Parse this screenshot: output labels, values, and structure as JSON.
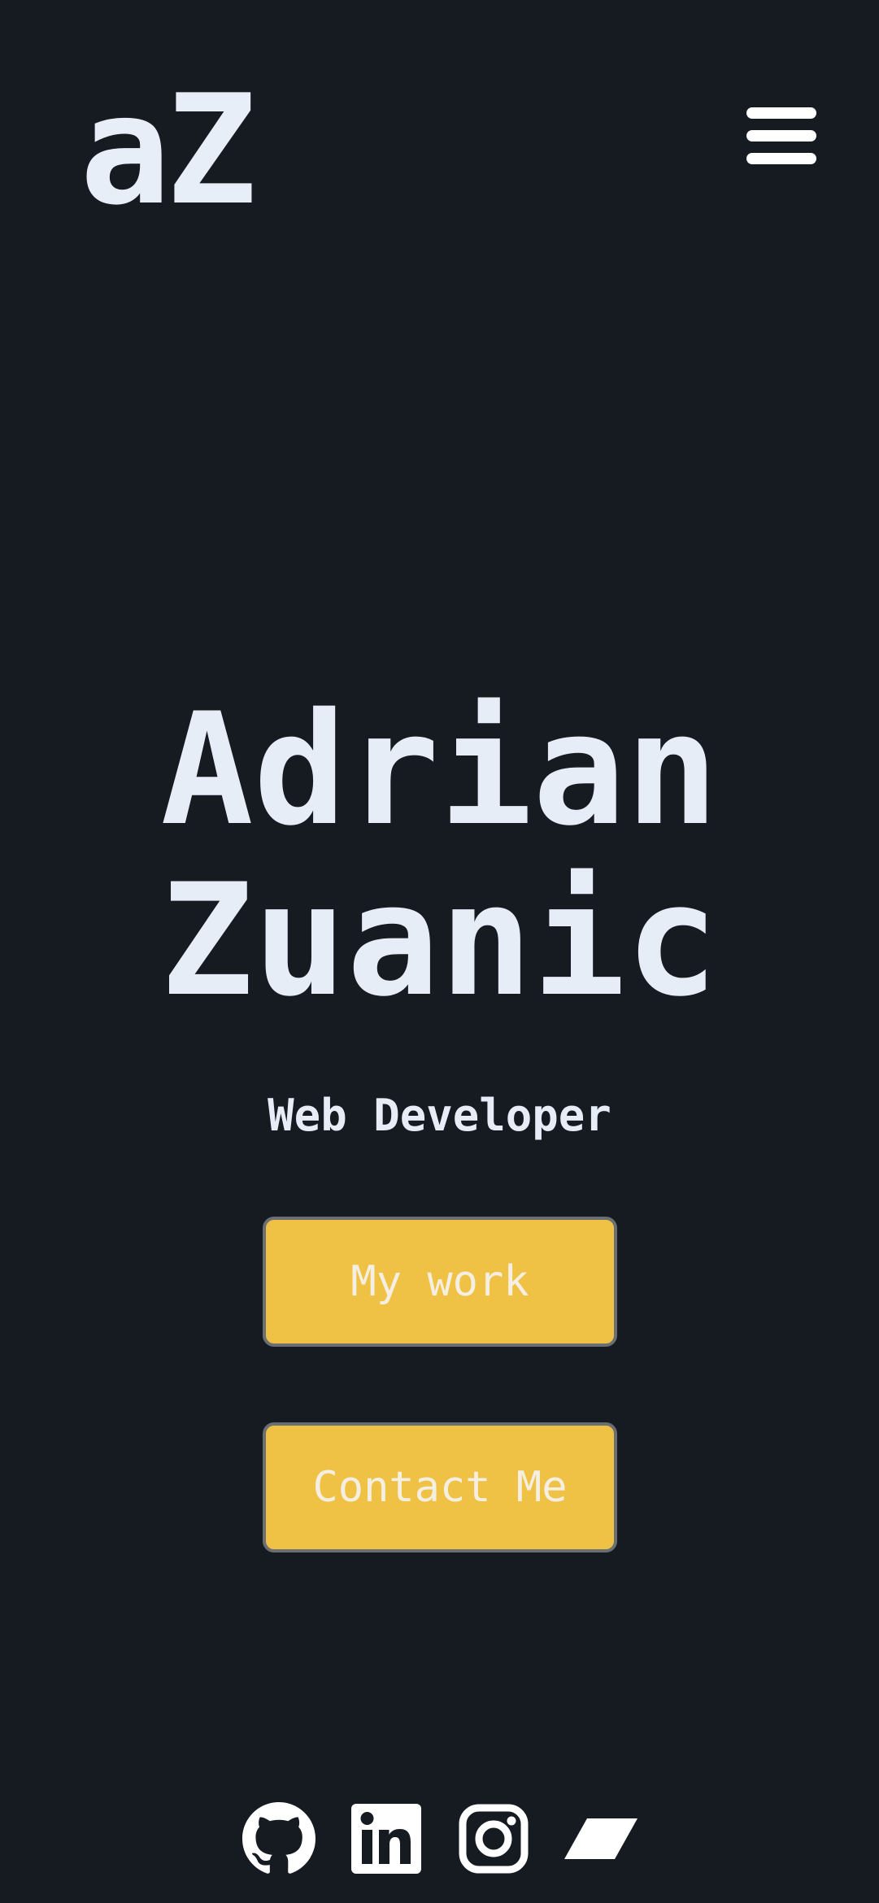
{
  "header": {
    "logo": "aZ",
    "menu_icon": "hamburger-menu-icon"
  },
  "hero": {
    "name_line1": "Adrian",
    "name_line2": "Zuanic",
    "subtitle": "Web Developer"
  },
  "buttons": {
    "work_label": "My work",
    "contact_label": "Contact Me"
  },
  "socials": [
    {
      "icon": "github-icon"
    },
    {
      "icon": "linkedin-icon"
    },
    {
      "icon": "instagram-icon"
    },
    {
      "icon": "parallelogram-logo-icon"
    }
  ],
  "colors": {
    "background": "#161b22",
    "text": "#e6edf7",
    "button_fill": "#efc245",
    "button_border": "#6b6f73",
    "button_text": "#f4efe2"
  }
}
